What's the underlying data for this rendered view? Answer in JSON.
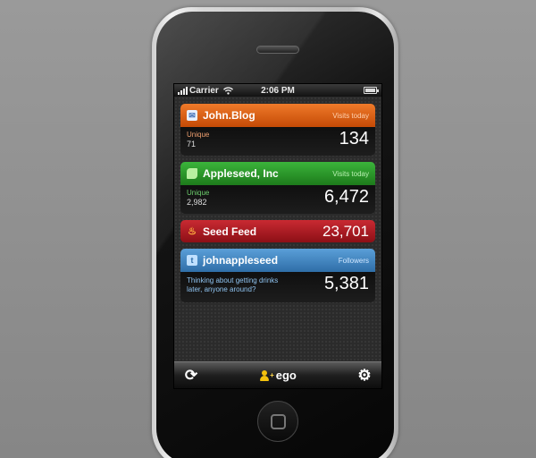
{
  "status_bar": {
    "carrier": "Carrier",
    "time": "2:06 PM"
  },
  "cards": {
    "blog": {
      "title": "John.Blog",
      "meta": "Visits today",
      "label": "Unique",
      "sub_value": "71",
      "value": "134",
      "color": "#e06010",
      "icon": "envelope-icon"
    },
    "appleseed": {
      "title": "Appleseed, Inc",
      "meta": "Visits today",
      "label": "Unique",
      "sub_value": "2,982",
      "value": "6,472",
      "color": "#2ea02a",
      "icon": "leaf-icon"
    },
    "feed": {
      "title": "Seed Feed",
      "value": "23,701",
      "color": "#b01820",
      "icon": "flame-icon"
    },
    "twitter": {
      "title": "johnappleseed",
      "meta": "Followers",
      "message": "Thinking about getting drinks later, anyone around?",
      "value": "5,381",
      "color": "#4a8cc8",
      "icon": "twitter-bird-icon"
    }
  },
  "toolbar": {
    "refresh_icon": "refresh-icon",
    "brand": "ego",
    "brand_mark": "+",
    "settings_icon": "gear-icon"
  }
}
